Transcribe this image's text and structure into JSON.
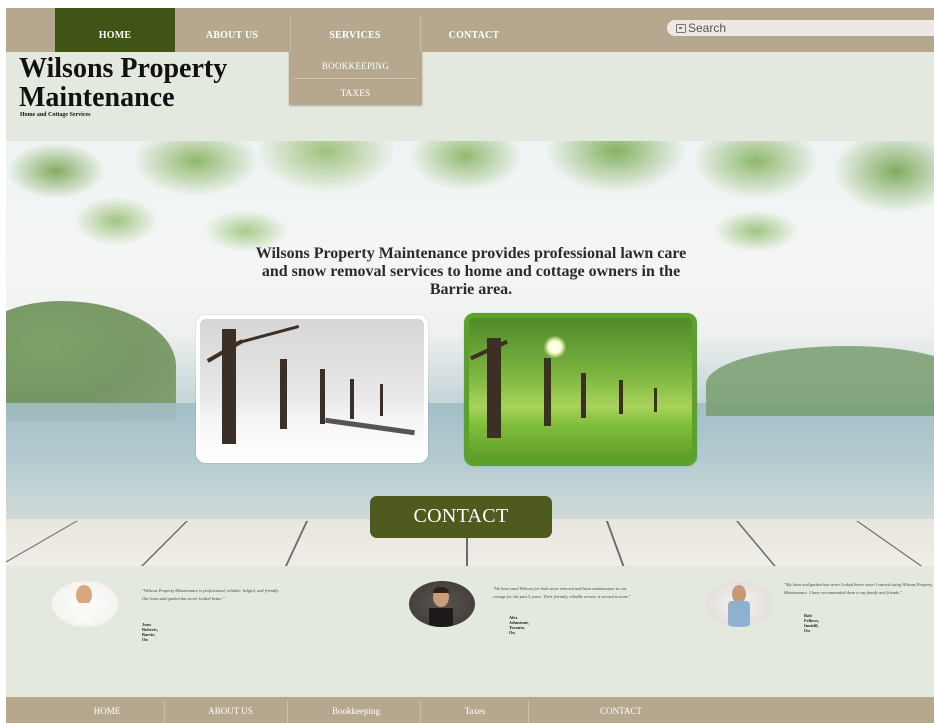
{
  "nav": {
    "home": "HOME",
    "about": "ABOUT US",
    "services": "SERVICES",
    "contact": "CONTACT"
  },
  "search": {
    "placeholder": "Search"
  },
  "services_dropdown": {
    "items": [
      "BOOKKEEPING",
      "TAXES"
    ]
  },
  "brand": {
    "title_line1": "Wilsons Property",
    "title_line2": "Maintenance",
    "subtitle": "Home and Cottage Services"
  },
  "hero": {
    "text": "Wilsons Property Maintenance provides professional lawn care and snow removal services to home and cottage owners in the Barrie area.",
    "cta": "CONTACT"
  },
  "testimonials": [
    {
      "quote": "\"Wilsons Property Maintenance is professional, reliable, helpful, and friendly. Our lawn and garden has never looked better.\"",
      "author": "Jean Roberts, Barrie, On"
    },
    {
      "quote": "\"We have used Wilsons for both snow removal and lawn maintenance at our cottage for the past 5 years. Their friendly, reliable service is second to none.\"",
      "author": "Alex Johnstone, Toronto, On"
    },
    {
      "quote": "\"My lawn and garden has never looked better since I started using Wilsons Property Maintenance. I have recommended them to my family and friends.\"",
      "author": "Rob Fellows, Innisfil, On"
    }
  ],
  "footer": {
    "home": "HOME",
    "about": "ABOUT US",
    "bookkeeping": "Bookkeeping",
    "taxes": "Taxes",
    "contact": "CONTACT"
  },
  "colors": {
    "nav_bg": "#b5a88f",
    "nav_active": "#3f5415",
    "page_bg": "#e4e9df",
    "cta_bg": "#4f5a1e",
    "summer_border": "#5aa228"
  },
  "icons": {
    "search": "search-icon"
  }
}
